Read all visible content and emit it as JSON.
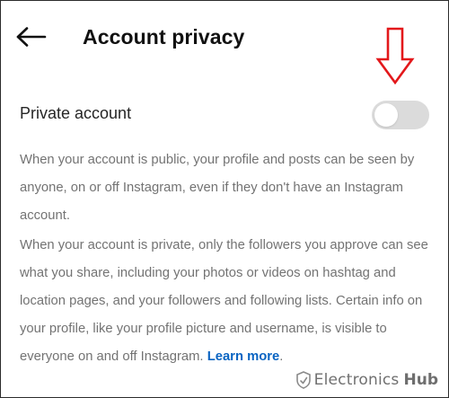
{
  "header": {
    "title": "Account privacy",
    "back_icon": "arrow-left-icon"
  },
  "annotation": {
    "icon": "red-down-arrow-icon",
    "color": "#e3181b"
  },
  "privacy_setting": {
    "label": "Private account",
    "toggle_on": false,
    "toggle_track_color": "#dbdbdb"
  },
  "description": {
    "public_text": "When your account is public, your profile and posts can be seen by anyone, on or off Instagram, even if they don't have an Instagram account.",
    "private_text": "When your account is private, only the followers you approve can see what you share, including your photos or videos on hashtag and location pages, and your followers and following lists. Certain info on your profile, like your profile picture and username, is visible to everyone on and off Instagram.",
    "learn_more": "Learn more",
    "period": ".",
    "link_color": "#0a64c2"
  },
  "watermark": {
    "brand": "Electronics",
    "suffix": "Hub",
    "icon": "shield-logo-icon"
  }
}
